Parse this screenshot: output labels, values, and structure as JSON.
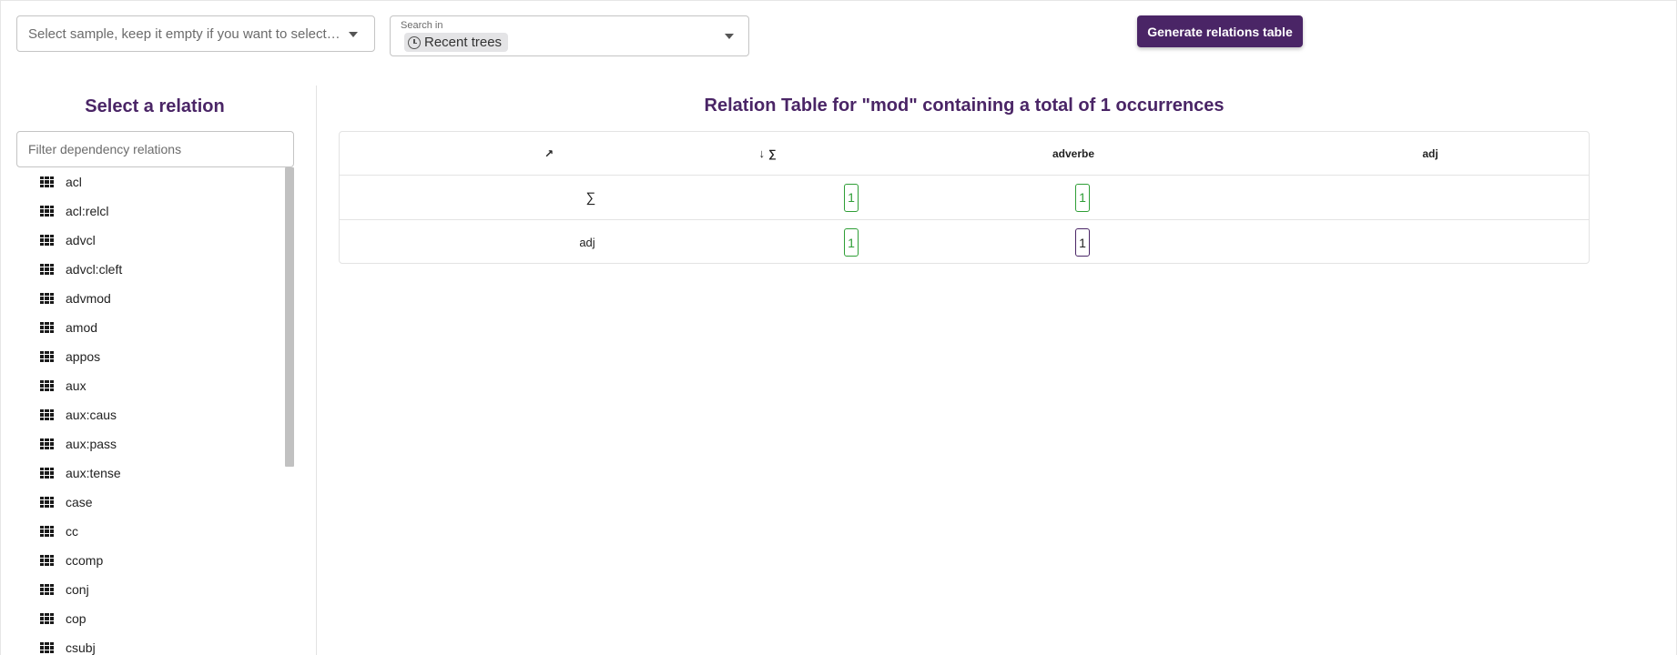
{
  "top_bar": {
    "sample_placeholder": "Select sample, keep it empty if you want to select all...",
    "search_in_label": "Search in",
    "search_in_chip": "Recent trees",
    "generate_button": "Generate relations table"
  },
  "sidebar": {
    "title": "Select a relation",
    "filter_placeholder": "Filter dependency relations",
    "items": [
      {
        "label": "acl",
        "icon": "grid-icon"
      },
      {
        "label": "acl:relcl",
        "icon": "grid-icon"
      },
      {
        "label": "advcl",
        "icon": "grid-icon"
      },
      {
        "label": "advcl:cleft",
        "icon": "grid-icon"
      },
      {
        "label": "advmod",
        "icon": "grid-icon"
      },
      {
        "label": "amod",
        "icon": "grid-icon"
      },
      {
        "label": "appos",
        "icon": "grid-icon"
      },
      {
        "label": "aux",
        "icon": "grid-icon"
      },
      {
        "label": "aux:caus",
        "icon": "grid-icon"
      },
      {
        "label": "aux:pass",
        "icon": "grid-icon"
      },
      {
        "label": "aux:tense",
        "icon": "grid-icon"
      },
      {
        "label": "case",
        "icon": "grid-icon"
      },
      {
        "label": "cc",
        "icon": "grid-icon"
      },
      {
        "label": "ccomp",
        "icon": "grid-icon"
      },
      {
        "label": "conj",
        "icon": "grid-icon"
      },
      {
        "label": "cop",
        "icon": "grid-icon"
      },
      {
        "label": "csubj",
        "icon": "grid-icon"
      }
    ]
  },
  "main": {
    "title": "Relation Table for \"mod\" containing a total of 1 occurrences",
    "table": {
      "corner": "↗",
      "sort_arrow": "↓",
      "sum_header": "∑",
      "columns": [
        "adverbe",
        "adj"
      ],
      "rows": [
        {
          "head": "∑",
          "sum": "1",
          "values": [
            "1",
            ""
          ]
        },
        {
          "head": "adj",
          "sum": "1",
          "values": [
            "1",
            ""
          ]
        }
      ]
    }
  },
  "colors": {
    "accent": "#4a2566",
    "count_badge": "#2e9e36"
  }
}
